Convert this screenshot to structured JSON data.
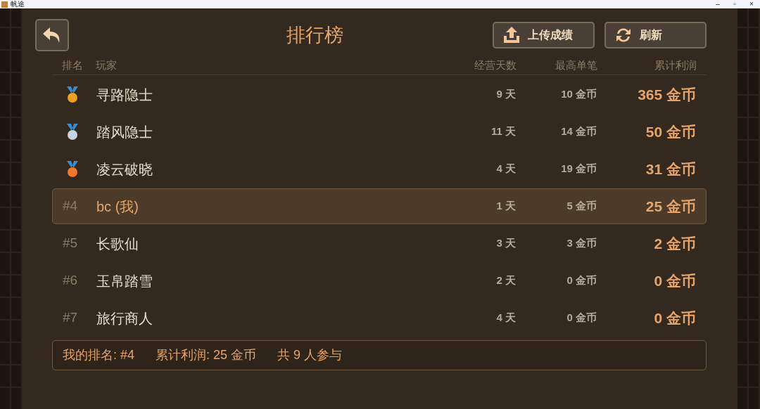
{
  "window": {
    "title": "帆途",
    "controls": [
      "–",
      "▫",
      "×"
    ]
  },
  "header": {
    "title": "排行榜",
    "buttons": [
      {
        "kind": "upload",
        "label": "上传成绩"
      },
      {
        "kind": "refresh",
        "label": "刷新"
      }
    ]
  },
  "table": {
    "columns": [
      "排名",
      "玩家",
      "经营天数",
      "最高单笔",
      "累计利润"
    ],
    "rows": [
      {
        "kind": "medal",
        "color": "#f0a020",
        "player": "寻路隐士",
        "days": "9 天",
        "best": "10 金币",
        "profit": "365 金币",
        "selected": false
      },
      {
        "kind": "medal",
        "color": "#c8d4e0",
        "player": "踏风隐士",
        "days": "11 天",
        "best": "14 金币",
        "profit": "50 金币",
        "selected": false
      },
      {
        "kind": "medal",
        "color": "#f07828",
        "player": "凌云破晓",
        "days": "4 天",
        "best": "19 金币",
        "profit": "31 金币",
        "selected": false
      },
      {
        "kind": "rank",
        "rank": "#4",
        "player": "bc (我)",
        "days": "1 天",
        "best": "5 金币",
        "profit": "25 金币",
        "selected": true
      },
      {
        "kind": "rank",
        "rank": "#5",
        "player": "长歌仙",
        "days": "3 天",
        "best": "3 金币",
        "profit": "2 金币",
        "selected": false
      },
      {
        "kind": "rank",
        "rank": "#6",
        "player": "玉帛踏雪",
        "days": "2 天",
        "best": "0 金币",
        "profit": "0 金币",
        "selected": false
      },
      {
        "kind": "rank",
        "rank": "#7",
        "player": "旅行商人",
        "days": "4 天",
        "best": "0 金币",
        "profit": "0 金币",
        "selected": false
      }
    ]
  },
  "footer": {
    "items": [
      "我的排名: #4",
      "累计利润: 25 金币",
      "共 9 人参与"
    ]
  }
}
